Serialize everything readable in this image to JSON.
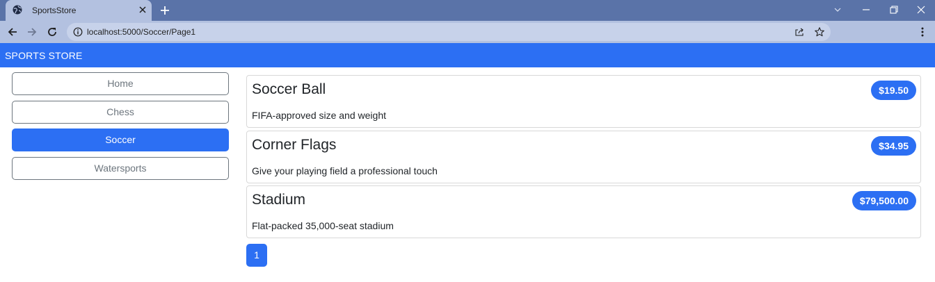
{
  "browser": {
    "tab_title": "SportsStore",
    "url": "localhost:5000/Soccer/Page1"
  },
  "site": {
    "brand": "SPORTS STORE"
  },
  "categories": [
    {
      "label": "Home",
      "active": false
    },
    {
      "label": "Chess",
      "active": false
    },
    {
      "label": "Soccer",
      "active": true
    },
    {
      "label": "Watersports",
      "active": false
    }
  ],
  "products": [
    {
      "name": "Soccer Ball",
      "price": "$19.50",
      "description": "FIFA-approved size and weight"
    },
    {
      "name": "Corner Flags",
      "price": "$34.95",
      "description": "Give your playing field a professional touch"
    },
    {
      "name": "Stadium",
      "price": "$79,500.00",
      "description": "Flat-packed 35,000-seat stadium"
    }
  ],
  "pagination": {
    "pages": [
      "1"
    ],
    "current": "1"
  },
  "colors": {
    "accent": "#2c6ff3",
    "tab_bar": "#5a73a8",
    "toolbar": "#b3c1e0"
  },
  "icons": [
    "globe-icon",
    "close-icon",
    "plus-icon",
    "chevron-down-icon",
    "minimize-icon",
    "restore-icon",
    "window-close-icon",
    "back-icon",
    "forward-icon",
    "reload-icon",
    "info-icon",
    "share-icon",
    "star-icon",
    "kebab-menu-icon"
  ]
}
